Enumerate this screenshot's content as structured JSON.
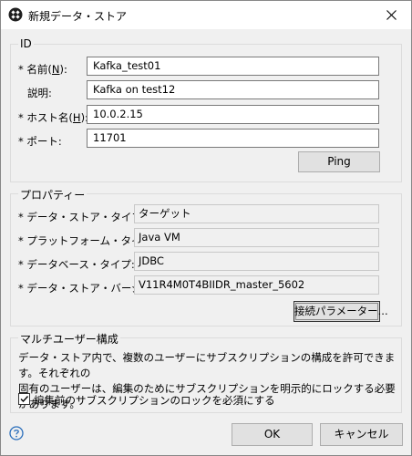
{
  "window": {
    "title": "新規データ・ストア"
  },
  "id_group": {
    "label": "ID",
    "name_label": "* 名前(",
    "name_mnemonic": "N",
    "name_value": "Kafka_test01",
    "desc_label": "説明:",
    "desc_value": "Kafka on test12",
    "host_label": "* ホスト名(",
    "host_mnemonic": "H",
    "host_value": "10.0.2.15",
    "port_label": "* ポート:",
    "port_value": "11701",
    "ping_label": "Ping"
  },
  "props_group": {
    "label": "プロパティー",
    "type_label": "* データ・ストア・タイプ:",
    "type_value": "ターゲット",
    "platform_label": "* プラットフォーム・タイプ:",
    "platform_value": "Java VM",
    "dbtype_label": "* データベース・タイプ:",
    "dbtype_value": "JDBC",
    "version_label": "* データ・ストア・バージョン:",
    "version_value": "V11R4M0T4BIIDR_master_5602",
    "conn_params_label": "接続パラメーター..."
  },
  "multi_group": {
    "label": "マルチユーザー構成",
    "description_line1": "データ・ストア内で、複数のユーザーにサブスクリプションの構成を許可できます。それぞれの",
    "description_line2": "固有のユーザーは、編集のためにサブスクリプションを明示的にロックする必要があります。",
    "lock_checkbox_label": "編集前のサブスクリプションのロックを必須にする",
    "lock_checked": true
  },
  "footer": {
    "ok_label": "OK",
    "cancel_label": "キャンセル"
  }
}
